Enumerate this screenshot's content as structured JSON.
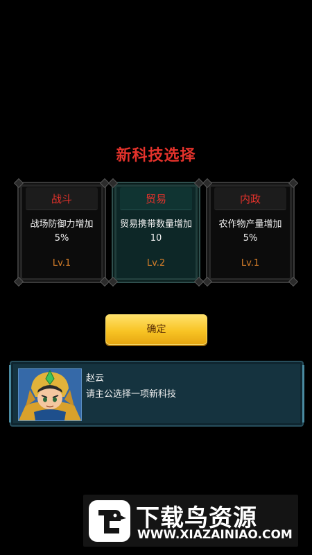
{
  "title": "新科技选择",
  "cards": [
    {
      "name": "战斗",
      "desc": "战场防御力增加 5%",
      "level": "Lv.1",
      "selected": false
    },
    {
      "name": "贸易",
      "desc": "贸易携带数量增加 10",
      "level": "Lv.2",
      "selected": true
    },
    {
      "name": "内政",
      "desc": "农作物产量增加 5%",
      "level": "Lv.1",
      "selected": false
    }
  ],
  "confirm_label": "确定",
  "dialog": {
    "speaker": "赵云",
    "message": "请主公选择一项新科技",
    "portrait_icon": "hero-portrait-icon"
  },
  "watermark": {
    "brand": "下载鸟资源",
    "url": "WWW.XIAZAINIAO.COM",
    "logo_icon": "bird-logo-icon"
  },
  "colors": {
    "title_red": "#e4322b",
    "level_orange": "#d9802a",
    "button_yellow": "#f8c425",
    "dialog_teal": "#15333f"
  }
}
